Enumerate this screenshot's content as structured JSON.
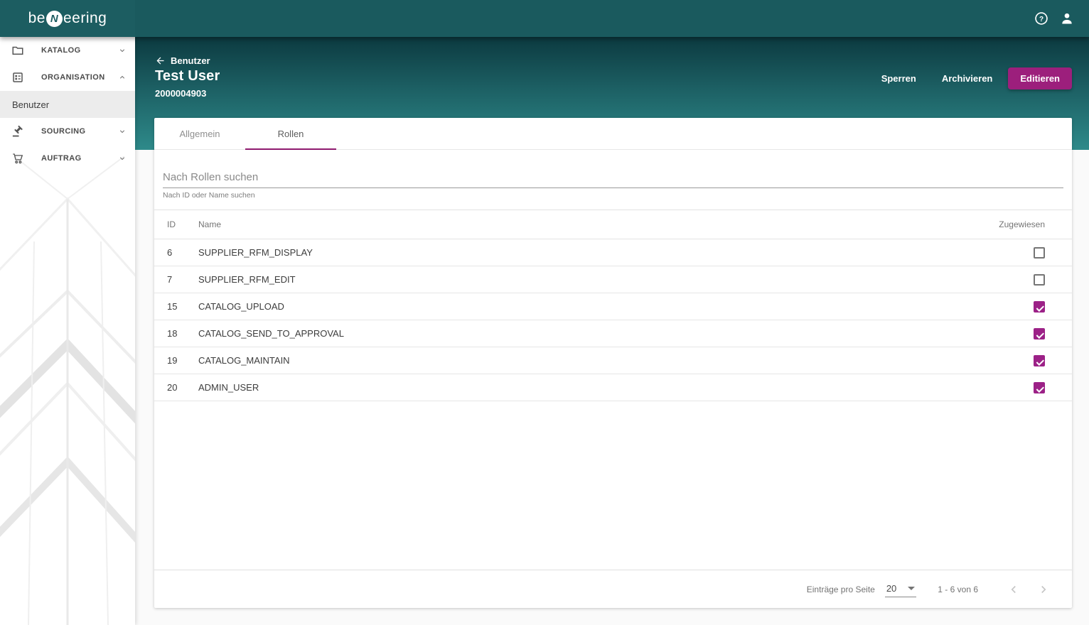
{
  "topbar": {
    "logo": {
      "prefix": "be",
      "emblem": "N",
      "suffix": "eering"
    },
    "icons": {
      "help": "help-circle",
      "user": "person"
    }
  },
  "sidebar": {
    "items": [
      {
        "label": "KATALOG",
        "icon": "folder",
        "state": "collapsed"
      },
      {
        "label": "ORGANISATION",
        "icon": "ballot",
        "state": "expanded"
      },
      {
        "label": "Benutzer",
        "type": "subitem",
        "active": true
      },
      {
        "label": "SOURCING",
        "icon": "gavel",
        "state": "collapsed"
      },
      {
        "label": "AUFTRAG",
        "icon": "cart",
        "state": "collapsed"
      }
    ]
  },
  "header": {
    "back_label": "Benutzer",
    "title": "Test User",
    "user_id": "2000004903",
    "actions": {
      "lock": "Sperren",
      "archive": "Archivieren",
      "edit": "Editieren"
    }
  },
  "tabs": [
    {
      "label": "Allgemein",
      "active": false
    },
    {
      "label": "Rollen",
      "active": true
    }
  ],
  "search": {
    "placeholder": "Nach Rollen suchen",
    "hint": "Nach ID oder Name suchen"
  },
  "roles_table": {
    "columns": {
      "id": "ID",
      "name": "Name",
      "assigned": "Zugewiesen"
    },
    "rows": [
      {
        "id": "6",
        "name": "SUPPLIER_RFM_DISPLAY",
        "assigned": false
      },
      {
        "id": "7",
        "name": "SUPPLIER_RFM_EDIT",
        "assigned": false
      },
      {
        "id": "15",
        "name": "CATALOG_UPLOAD",
        "assigned": true
      },
      {
        "id": "18",
        "name": "CATALOG_SEND_TO_APPROVAL",
        "assigned": true
      },
      {
        "id": "19",
        "name": "CATALOG_MAINTAIN",
        "assigned": true
      },
      {
        "id": "20",
        "name": "ADMIN_USER",
        "assigned": true
      }
    ]
  },
  "pagination": {
    "per_page_label": "Einträge pro Seite",
    "per_page_value": "20",
    "range": "1 - 6 von 6"
  },
  "colors": {
    "topbar_teal": "#1a5a5e",
    "header_gradient_top": "#0c3a40",
    "header_gradient_bottom": "#2e8a8a",
    "brand_magenta": "#9c1f7c",
    "tab_underline": "#8e1a6e",
    "active_nav_bg": "#ececec"
  }
}
